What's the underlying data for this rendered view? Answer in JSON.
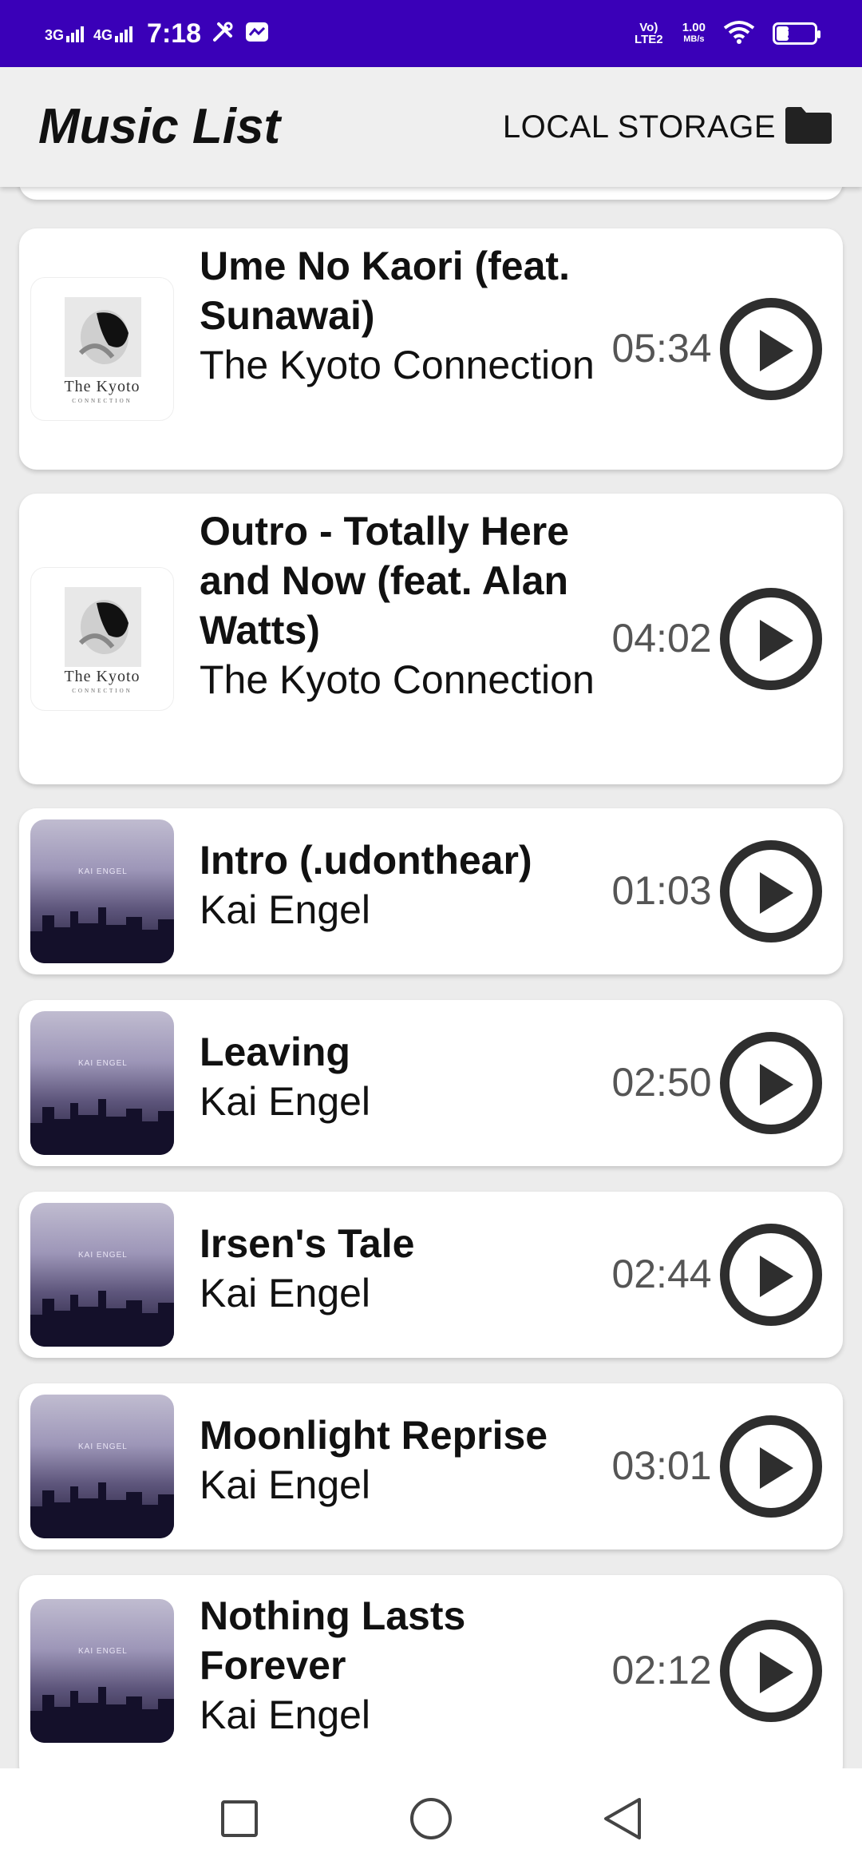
{
  "status_bar": {
    "net1": "3G",
    "net2": "4G",
    "time": "7:18",
    "volte": "Vo) LTE2",
    "speed_value": "1.00",
    "speed_unit": "MB/s",
    "battery": "29",
    "battery_level": 0.29
  },
  "app_bar": {
    "title": "Music List",
    "storage_label": "LOCAL STORAGE"
  },
  "songs": [
    {
      "title": "Ume No Kaori (feat. Sunawai)",
      "artist": "The Kyoto Connection",
      "duration": "05:34",
      "art": "kyoto"
    },
    {
      "title": "Outro - Totally Here and Now (feat. Alan Watts)",
      "artist": "The Kyoto Connection",
      "duration": "04:02",
      "art": "kyoto"
    },
    {
      "title": "Intro (.udonthear)",
      "artist": "Kai Engel",
      "duration": "01:03",
      "art": "kai"
    },
    {
      "title": "Leaving",
      "artist": "Kai Engel",
      "duration": "02:50",
      "art": "kai"
    },
    {
      "title": "Irsen's Tale",
      "artist": "Kai Engel",
      "duration": "02:44",
      "art": "kai"
    },
    {
      "title": "Moonlight Reprise",
      "artist": "Kai Engel",
      "duration": "03:01",
      "art": "kai"
    },
    {
      "title": "Nothing Lasts Forever",
      "artist": "Kai Engel",
      "duration": "02:12",
      "art": "kai"
    }
  ],
  "album_art_text": {
    "kyoto_main": "The Kyoto",
    "kyoto_sub": "CONNECTION",
    "kai": "KAI ENGEL"
  },
  "colors": {
    "status_bar": "#3a00b8",
    "app_bar": "#efefef",
    "play_icon": "#2e2e2e"
  }
}
